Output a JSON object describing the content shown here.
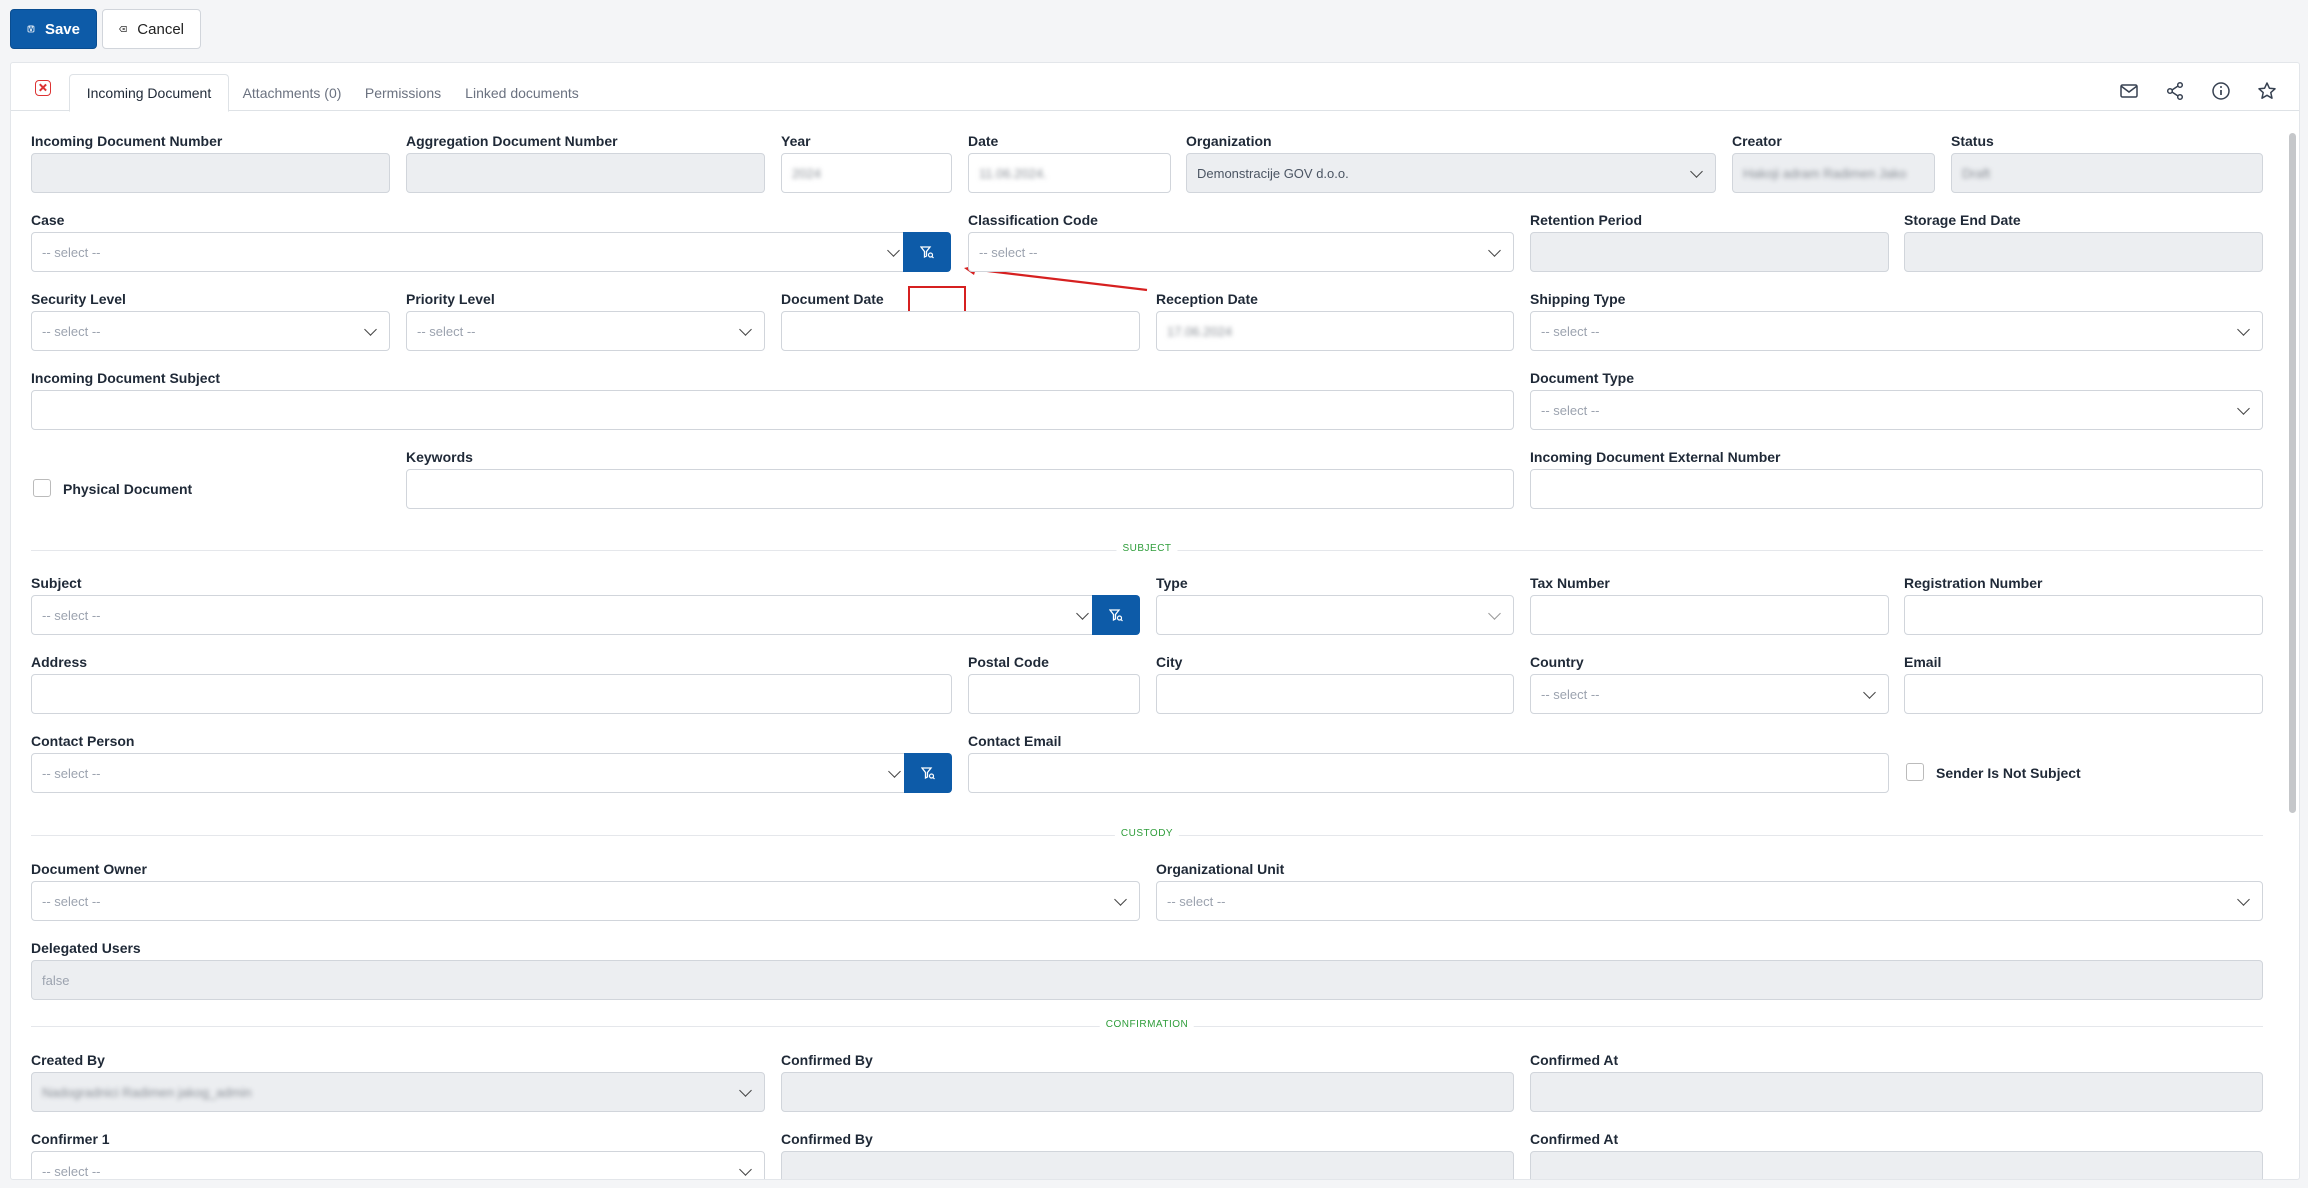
{
  "toolbar": {
    "save_label": "Save",
    "cancel_label": "Cancel"
  },
  "tabs": [
    "Incoming Document",
    "Attachments (0)",
    "Permissions",
    "Linked documents"
  ],
  "fields": {
    "incoming_doc_number": "Incoming Document Number",
    "aggregation_doc_number": "Aggregation Document Number",
    "year": "Year",
    "year_value": "2024",
    "date": "Date",
    "date_value": "11.06.2024.",
    "organization": "Organization",
    "organization_value": "Demonstracije GOV d.o.o.",
    "creator": "Creator",
    "creator_value": "Hakoji adram Radimen Jako",
    "status": "Status",
    "status_value": "Draft",
    "case": "Case",
    "classification_code": "Classification Code",
    "retention_period": "Retention Period",
    "storage_end_date": "Storage End Date",
    "security_level": "Security Level",
    "priority_level": "Priority Level",
    "document_date": "Document Date",
    "reception_date": "Reception Date",
    "reception_date_value": "17.06.2024",
    "shipping_type": "Shipping Type",
    "incoming_doc_subject": "Incoming Document Subject",
    "document_type": "Document Type",
    "physical_document": "Physical Document",
    "keywords": "Keywords",
    "incoming_doc_external_number": "Incoming Document External Number",
    "subject": "Subject",
    "type": "Type",
    "tax_number": "Tax Number",
    "registration_number": "Registration Number",
    "address": "Address",
    "postal_code": "Postal Code",
    "city": "City",
    "country": "Country",
    "email": "Email",
    "contact_person": "Contact Person",
    "contact_email": "Contact Email",
    "sender_is_not_subject": "Sender Is Not Subject",
    "document_owner": "Document Owner",
    "organizational_unit": "Organizational Unit",
    "delegated_users": "Delegated Users",
    "delegated_users_value": "false",
    "created_by": "Created By",
    "created_by_value": "Nadogradnici Radimen jakog_admin",
    "confirmed_by": "Confirmed By",
    "confirmed_at": "Confirmed At",
    "confirmer_1": "Confirmer 1"
  },
  "select_placeholder": "-- select --",
  "sections": {
    "subject": "SUBJECT",
    "custody": "CUSTODY",
    "confirmation": "CONFIRMATION"
  },
  "colors": {
    "primary": "#0d5ba8",
    "section_green": "#2e9d3a",
    "highlight_red": "#d62020"
  },
  "icons": [
    "save-icon",
    "cancel-icon",
    "close-tab-icon",
    "mail-icon",
    "share-icon",
    "info-icon",
    "star-icon",
    "filter-search-icon"
  ]
}
